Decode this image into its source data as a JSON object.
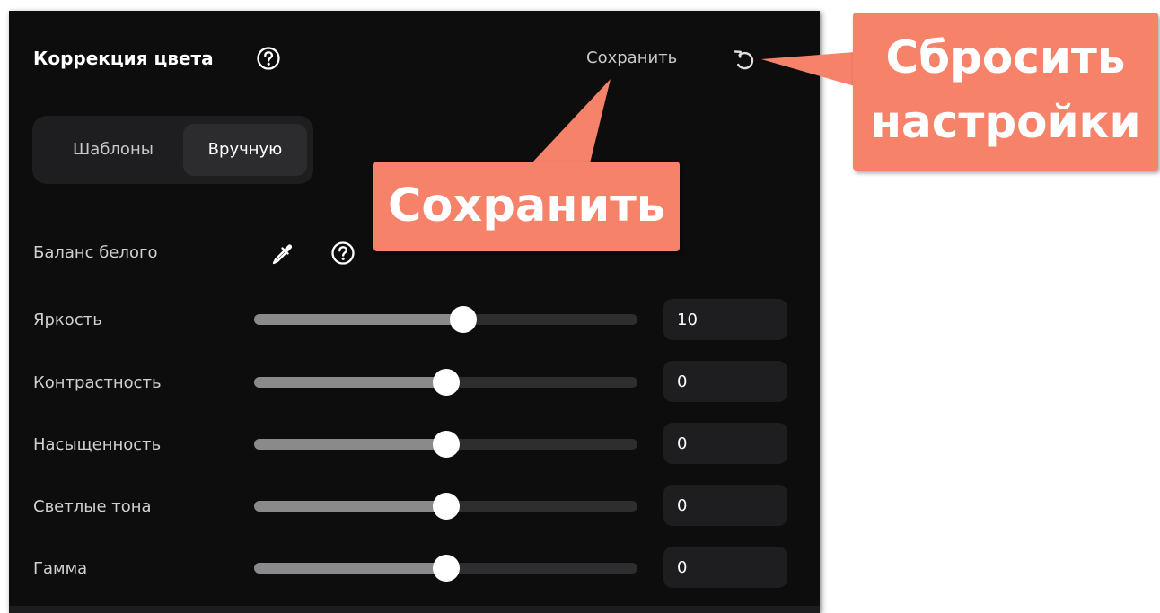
{
  "header": {
    "title": "Коррекция цвета",
    "save_label": "Сохранить",
    "help_icon": "help-circle-icon",
    "reset_icon": "reset-icon"
  },
  "mode_tabs": {
    "items": [
      {
        "label": "Шаблоны",
        "selected": false
      },
      {
        "label": "Вручную",
        "selected": true
      }
    ]
  },
  "white_balance": {
    "label": "Баланс белого",
    "pipette_icon": "eyedropper-icon",
    "help_icon": "help-circle-icon"
  },
  "sliders": [
    {
      "label": "Яркость",
      "value": "10",
      "position": 0.545
    },
    {
      "label": "Контрастность",
      "value": "0",
      "position": 0.5
    },
    {
      "label": "Насыщенность",
      "value": "0",
      "position": 0.5
    },
    {
      "label": "Светлые тона",
      "value": "0",
      "position": 0.5
    },
    {
      "label": "Гамма",
      "value": "0",
      "position": 0.5
    }
  ],
  "callouts": {
    "save": "Сохранить",
    "reset_line1": "Сбросить",
    "reset_line2": "настройки"
  },
  "colors": {
    "panel_bg": "#0d0d0e",
    "callout_bg": "#f7826a",
    "track": "#2e2e31",
    "track_fill": "#8a8a8d"
  }
}
